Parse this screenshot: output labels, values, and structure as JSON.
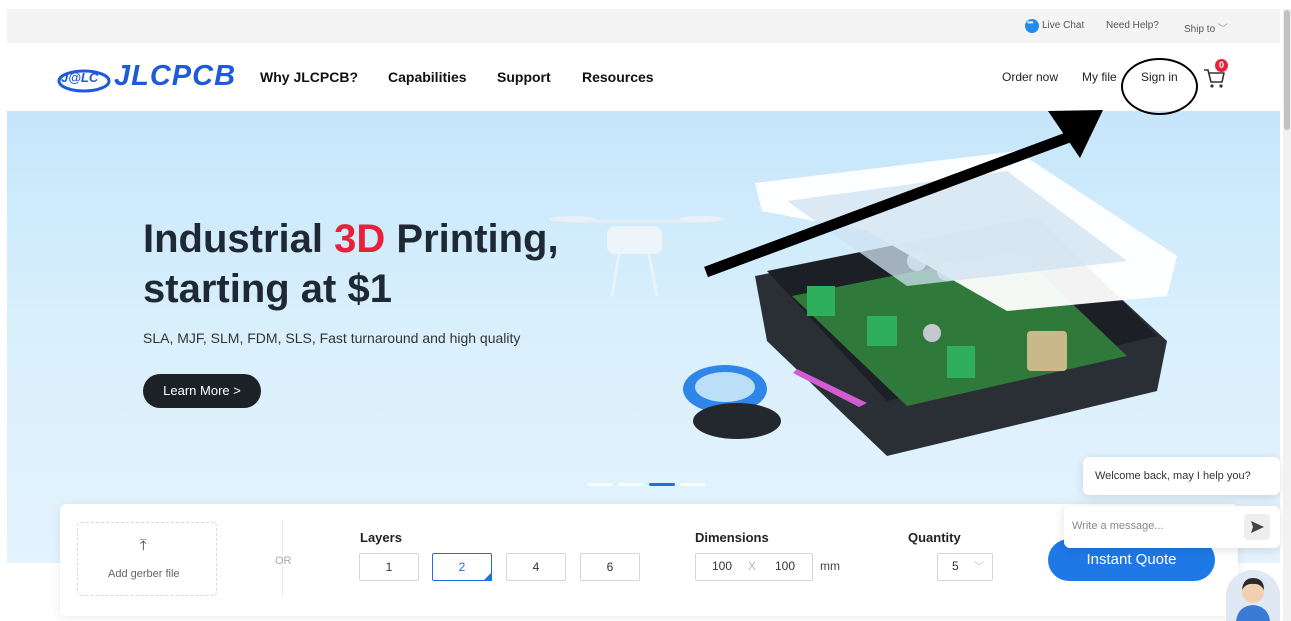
{
  "util_bar": {
    "live_chat": "Live Chat",
    "need_help": "Need Help?",
    "ship_to": "Ship to"
  },
  "header": {
    "logo_mark": "J@LC",
    "logo_text": "JLCPCB",
    "nav": [
      "Why JLCPCB?",
      "Capabilities",
      "Support",
      "Resources"
    ],
    "order_now": "Order now",
    "my_file": "My file",
    "sign_in": "Sign in",
    "cart_count": "0"
  },
  "hero": {
    "title_line1_pre": "Industrial ",
    "title_accent": "3D",
    "title_line1_post": " Printing,",
    "title_line2": "starting at $1",
    "subtitle": "SLA, MJF, SLM, FDM, SLS, Fast turnaround and high quality",
    "cta": "Learn More >",
    "active_slide": 3,
    "slides": 4
  },
  "quote": {
    "upload_label": "Add gerber file",
    "or": "OR",
    "layers_label": "Layers",
    "layers": [
      "1",
      "2",
      "4",
      "6"
    ],
    "layers_selected": "2",
    "dimensions_label": "Dimensions",
    "dim_w": "100",
    "dim_x": "X",
    "dim_h": "100",
    "dim_unit": "mm",
    "quantity_label": "Quantity",
    "quantity": "5",
    "instant_quote": "Instant Quote"
  },
  "chat": {
    "welcome": "Welcome back, may I help you?",
    "placeholder": "Write a message..."
  },
  "colors": {
    "brand_blue": "#1e5bd8",
    "accent_red": "#e8203a",
    "button_blue": "#1e78e6"
  }
}
